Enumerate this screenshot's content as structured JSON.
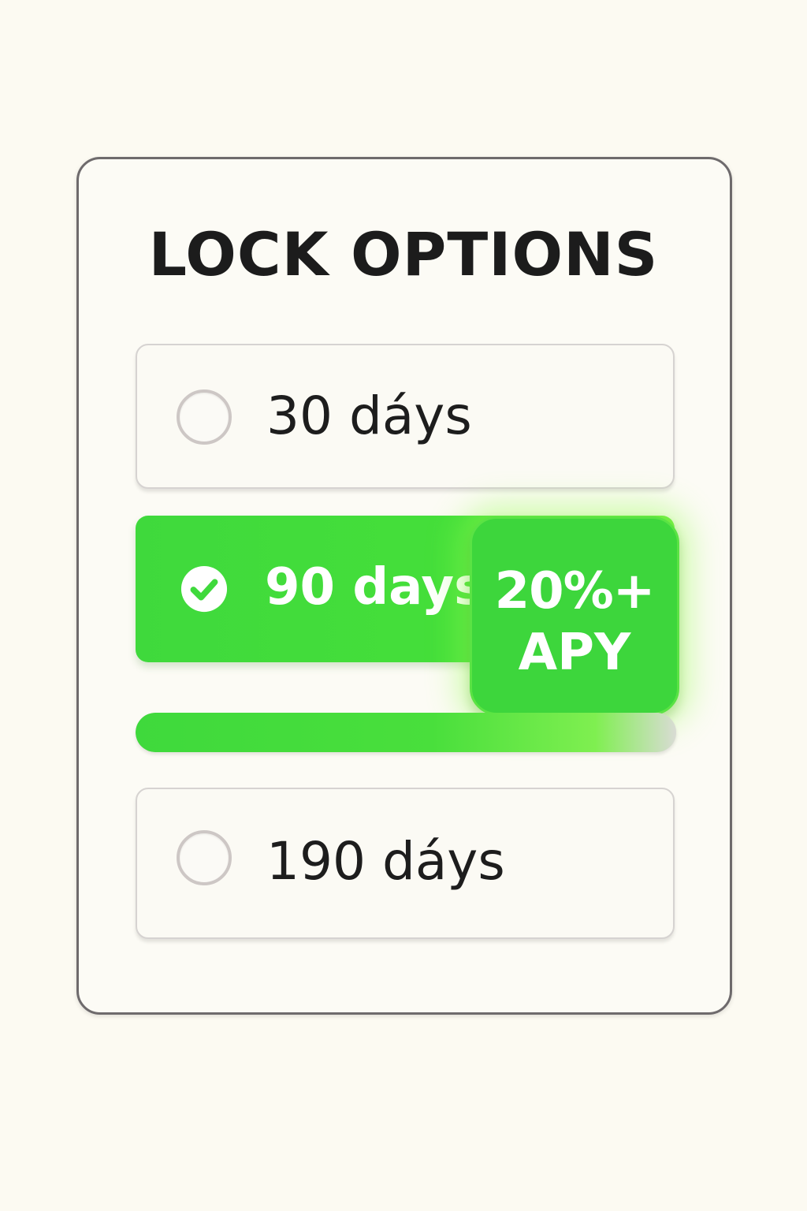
{
  "title": "LOCK OPTIONS",
  "options": [
    {
      "label": "30 dáys",
      "selected": false
    },
    {
      "label": "90 days",
      "selected": true
    },
    {
      "label": "190 dáys",
      "selected": false
    }
  ],
  "badge": {
    "value": "20%+",
    "unit": "APY"
  },
  "progress": {
    "fraction": 1.0
  },
  "colors": {
    "accent": "#3fd93c",
    "background": "#fcfaf2",
    "text": "#1c1c1c",
    "border": "#6e6a6c"
  },
  "icons": {
    "selected": "check-circle-icon",
    "unselected": "radio-empty-icon"
  }
}
